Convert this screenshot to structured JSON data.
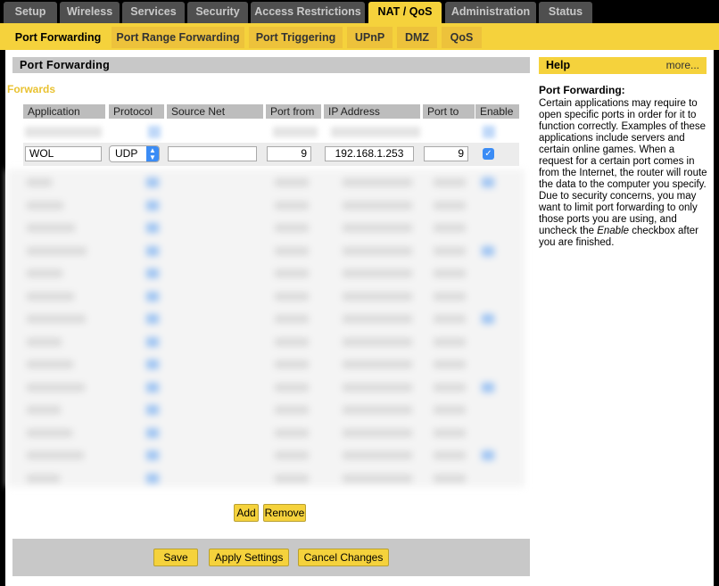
{
  "main_tabs": [
    {
      "label": "Setup"
    },
    {
      "label": "Wireless"
    },
    {
      "label": "Services"
    },
    {
      "label": "Security"
    },
    {
      "label": "Access Restrictions"
    },
    {
      "label": "NAT / QoS",
      "active": true
    },
    {
      "label": "Administration"
    },
    {
      "label": "Status"
    }
  ],
  "sub_tabs": [
    {
      "label": "Port Forwarding",
      "active": true
    },
    {
      "label": "Port Range Forwarding"
    },
    {
      "label": "Port Triggering"
    },
    {
      "label": "UPnP"
    },
    {
      "label": "DMZ"
    },
    {
      "label": "QoS"
    }
  ],
  "section_title": "Port Forwarding",
  "forwards_label": "Forwards",
  "columns": [
    "Application",
    "Protocol",
    "Source Net",
    "Port from",
    "IP Address",
    "Port to",
    "Enable"
  ],
  "row": {
    "application": "WOL",
    "protocol": "UDP",
    "source_net": "",
    "port_from": "9",
    "ip_address": "192.168.1.253",
    "port_to": "9",
    "enable": true
  },
  "buttons": {
    "add": "Add",
    "remove": "Remove",
    "save": "Save",
    "apply": "Apply Settings",
    "cancel": "Cancel Changes"
  },
  "help": {
    "heading": "Help",
    "more": "more...",
    "title": "Port Forwarding:",
    "text_part1": "Certain applications may require to open specific ports in order for it to function correctly. Examples of these applications include servers and certain online games. When a request for a certain port comes in from the Internet, the router will route the data to the computer you specify. Due to security concerns, you may want to limit port forwarding to only those ports you are using, and uncheck the ",
    "text_em": "Enable",
    "text_part2": " checkbox after you are finished."
  },
  "colors": {
    "accent": "#f5d23c",
    "tab_inactive": "#4f4f4f",
    "checkbox": "#3b8cf5"
  }
}
